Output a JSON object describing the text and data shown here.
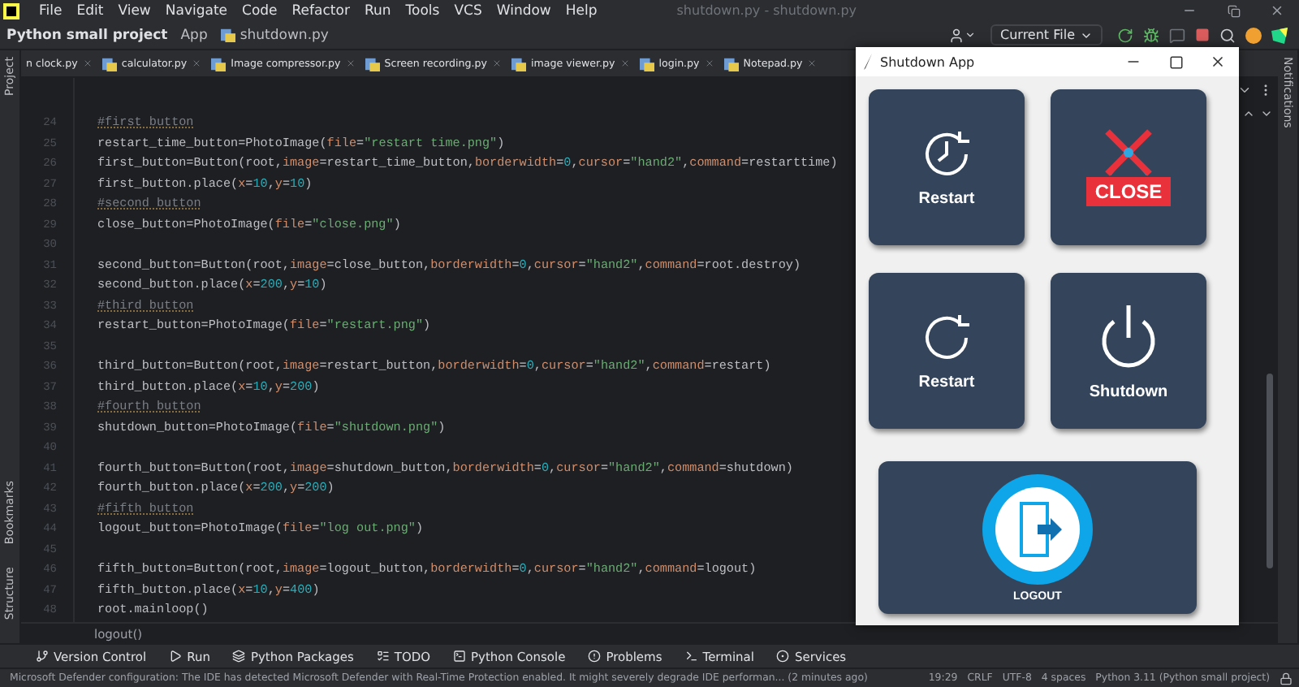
{
  "window": {
    "title": "shutdown.py - shutdown.py"
  },
  "menu": [
    "File",
    "Edit",
    "View",
    "Navigate",
    "Code",
    "Refactor",
    "Run",
    "Tools",
    "VCS",
    "Window",
    "Help"
  ],
  "breadcrumbs": [
    "Python small project",
    "App",
    "shutdown.py"
  ],
  "toolbar": {
    "run_configuration": "Current File"
  },
  "left_tools_top": [
    "Project"
  ],
  "left_tools_bottom": [
    "Bookmarks",
    "Structure"
  ],
  "right_tools": [
    "Notifications"
  ],
  "tabs": [
    "n clock.py",
    "calculator.py",
    "Image compressor.py",
    "Screen recording.py",
    "image viewer.py",
    "login.py",
    "Notepad.py"
  ],
  "editor": {
    "lines": [
      {
        "number": "24",
        "code": [
          {
            "kind": "comment",
            "text": "#first button"
          }
        ]
      },
      {
        "number": "25",
        "code": [
          {
            "kind": "plain",
            "text": "restart_time_button=PhotoImage("
          },
          {
            "kind": "param",
            "text": "file"
          },
          {
            "kind": "plain",
            "text": "="
          },
          {
            "kind": "string",
            "text": "\"restart time.png\""
          },
          {
            "kind": "plain",
            "text": ")"
          }
        ]
      },
      {
        "number": "26",
        "code": [
          {
            "kind": "plain",
            "text": "first_button=Button(root,"
          },
          {
            "kind": "param",
            "text": "image"
          },
          {
            "kind": "plain",
            "text": "=restart_time_button,"
          },
          {
            "kind": "param",
            "text": "borderwidth"
          },
          {
            "kind": "plain",
            "text": "="
          },
          {
            "kind": "number",
            "text": "0"
          },
          {
            "kind": "plain",
            "text": ","
          },
          {
            "kind": "param",
            "text": "cursor"
          },
          {
            "kind": "plain",
            "text": "="
          },
          {
            "kind": "string",
            "text": "\"hand2\""
          },
          {
            "kind": "plain",
            "text": ","
          },
          {
            "kind": "param",
            "text": "command"
          },
          {
            "kind": "plain",
            "text": "=restarttime)"
          }
        ]
      },
      {
        "number": "27",
        "code": [
          {
            "kind": "plain",
            "text": "first_button.place("
          },
          {
            "kind": "param",
            "text": "x"
          },
          {
            "kind": "plain",
            "text": "="
          },
          {
            "kind": "number",
            "text": "10"
          },
          {
            "kind": "plain",
            "text": ","
          },
          {
            "kind": "param",
            "text": "y"
          },
          {
            "kind": "plain",
            "text": "="
          },
          {
            "kind": "number",
            "text": "10"
          },
          {
            "kind": "plain",
            "text": ")"
          }
        ]
      },
      {
        "number": "28",
        "code": [
          {
            "kind": "comment",
            "text": "#second button"
          }
        ]
      },
      {
        "number": "29",
        "code": [
          {
            "kind": "plain",
            "text": "close_button=PhotoImage("
          },
          {
            "kind": "param",
            "text": "file"
          },
          {
            "kind": "plain",
            "text": "="
          },
          {
            "kind": "string",
            "text": "\"close.png\""
          },
          {
            "kind": "plain",
            "text": ")"
          }
        ]
      },
      {
        "number": "30"
      },
      {
        "number": "31",
        "code": [
          {
            "kind": "plain",
            "text": "second_button=Button(root,"
          },
          {
            "kind": "param",
            "text": "image"
          },
          {
            "kind": "plain",
            "text": "=close_button,"
          },
          {
            "kind": "param",
            "text": "borderwidth"
          },
          {
            "kind": "plain",
            "text": "="
          },
          {
            "kind": "number",
            "text": "0"
          },
          {
            "kind": "plain",
            "text": ","
          },
          {
            "kind": "param",
            "text": "cursor"
          },
          {
            "kind": "plain",
            "text": "="
          },
          {
            "kind": "string",
            "text": "\"hand2\""
          },
          {
            "kind": "plain",
            "text": ","
          },
          {
            "kind": "param",
            "text": "command"
          },
          {
            "kind": "plain",
            "text": "=root.destroy)"
          }
        ]
      },
      {
        "number": "32",
        "code": [
          {
            "kind": "plain",
            "text": "second_button.place("
          },
          {
            "kind": "param",
            "text": "x"
          },
          {
            "kind": "plain",
            "text": "="
          },
          {
            "kind": "number",
            "text": "200"
          },
          {
            "kind": "plain",
            "text": ","
          },
          {
            "kind": "param",
            "text": "y"
          },
          {
            "kind": "plain",
            "text": "="
          },
          {
            "kind": "number",
            "text": "10"
          },
          {
            "kind": "plain",
            "text": ")"
          }
        ]
      },
      {
        "number": "33",
        "code": [
          {
            "kind": "comment",
            "text": "#third button"
          }
        ]
      },
      {
        "number": "34",
        "code": [
          {
            "kind": "plain",
            "text": "restart_button=PhotoImage("
          },
          {
            "kind": "param",
            "text": "file"
          },
          {
            "kind": "plain",
            "text": "="
          },
          {
            "kind": "string",
            "text": "\"restart.png\""
          },
          {
            "kind": "plain",
            "text": ")"
          }
        ]
      },
      {
        "number": "35"
      },
      {
        "number": "36",
        "code": [
          {
            "kind": "plain",
            "text": "third_button=Button(root,"
          },
          {
            "kind": "param",
            "text": "image"
          },
          {
            "kind": "plain",
            "text": "=restart_button,"
          },
          {
            "kind": "param",
            "text": "borderwidth"
          },
          {
            "kind": "plain",
            "text": "="
          },
          {
            "kind": "number",
            "text": "0"
          },
          {
            "kind": "plain",
            "text": ","
          },
          {
            "kind": "param",
            "text": "cursor"
          },
          {
            "kind": "plain",
            "text": "="
          },
          {
            "kind": "string",
            "text": "\"hand2\""
          },
          {
            "kind": "plain",
            "text": ","
          },
          {
            "kind": "param",
            "text": "command"
          },
          {
            "kind": "plain",
            "text": "=restart)"
          }
        ]
      },
      {
        "number": "37",
        "code": [
          {
            "kind": "plain",
            "text": "third_button.place("
          },
          {
            "kind": "param",
            "text": "x"
          },
          {
            "kind": "plain",
            "text": "="
          },
          {
            "kind": "number",
            "text": "10"
          },
          {
            "kind": "plain",
            "text": ","
          },
          {
            "kind": "param",
            "text": "y"
          },
          {
            "kind": "plain",
            "text": "="
          },
          {
            "kind": "number",
            "text": "200"
          },
          {
            "kind": "plain",
            "text": ")"
          }
        ]
      },
      {
        "number": "38",
        "code": [
          {
            "kind": "comment",
            "text": "#fourth button"
          }
        ]
      },
      {
        "number": "39",
        "code": [
          {
            "kind": "plain",
            "text": "shutdown_button=PhotoImage("
          },
          {
            "kind": "param",
            "text": "file"
          },
          {
            "kind": "plain",
            "text": "="
          },
          {
            "kind": "string",
            "text": "\"shutdown.png\""
          },
          {
            "kind": "plain",
            "text": ")"
          }
        ]
      },
      {
        "number": "40"
      },
      {
        "number": "41",
        "code": [
          {
            "kind": "plain",
            "text": "fourth_button=Button(root,"
          },
          {
            "kind": "param",
            "text": "image"
          },
          {
            "kind": "plain",
            "text": "=shutdown_button,"
          },
          {
            "kind": "param",
            "text": "borderwidth"
          },
          {
            "kind": "plain",
            "text": "="
          },
          {
            "kind": "number",
            "text": "0"
          },
          {
            "kind": "plain",
            "text": ","
          },
          {
            "kind": "param",
            "text": "cursor"
          },
          {
            "kind": "plain",
            "text": "="
          },
          {
            "kind": "string",
            "text": "\"hand2\""
          },
          {
            "kind": "plain",
            "text": ","
          },
          {
            "kind": "param",
            "text": "command"
          },
          {
            "kind": "plain",
            "text": "=shutdown)"
          }
        ]
      },
      {
        "number": "42",
        "code": [
          {
            "kind": "plain",
            "text": "fourth_button.place("
          },
          {
            "kind": "param",
            "text": "x"
          },
          {
            "kind": "plain",
            "text": "="
          },
          {
            "kind": "number",
            "text": "200"
          },
          {
            "kind": "plain",
            "text": ","
          },
          {
            "kind": "param",
            "text": "y"
          },
          {
            "kind": "plain",
            "text": "="
          },
          {
            "kind": "number",
            "text": "200"
          },
          {
            "kind": "plain",
            "text": ")"
          }
        ]
      },
      {
        "number": "43",
        "code": [
          {
            "kind": "comment",
            "text": "#fifth button"
          }
        ]
      },
      {
        "number": "44",
        "code": [
          {
            "kind": "plain",
            "text": "logout_button=PhotoImage("
          },
          {
            "kind": "param",
            "text": "file"
          },
          {
            "kind": "plain",
            "text": "="
          },
          {
            "kind": "string",
            "text": "\"log out.png\""
          },
          {
            "kind": "plain",
            "text": ")"
          }
        ]
      },
      {
        "number": "45"
      },
      {
        "number": "46",
        "code": [
          {
            "kind": "plain",
            "text": "fifth_button=Button(root,"
          },
          {
            "kind": "param",
            "text": "image"
          },
          {
            "kind": "plain",
            "text": "=logout_button,"
          },
          {
            "kind": "param",
            "text": "borderwidth"
          },
          {
            "kind": "plain",
            "text": "="
          },
          {
            "kind": "number",
            "text": "0"
          },
          {
            "kind": "plain",
            "text": ","
          },
          {
            "kind": "param",
            "text": "cursor"
          },
          {
            "kind": "plain",
            "text": "="
          },
          {
            "kind": "string",
            "text": "\"hand2\""
          },
          {
            "kind": "plain",
            "text": ","
          },
          {
            "kind": "param",
            "text": "command"
          },
          {
            "kind": "plain",
            "text": "=logout)"
          }
        ]
      },
      {
        "number": "47",
        "code": [
          {
            "kind": "plain",
            "text": "fifth_button.place("
          },
          {
            "kind": "param",
            "text": "x"
          },
          {
            "kind": "plain",
            "text": "="
          },
          {
            "kind": "number",
            "text": "10"
          },
          {
            "kind": "plain",
            "text": ","
          },
          {
            "kind": "param",
            "text": "y"
          },
          {
            "kind": "plain",
            "text": "="
          },
          {
            "kind": "number",
            "text": "400"
          },
          {
            "kind": "plain",
            "text": ")"
          }
        ]
      },
      {
        "number": "48",
        "code": [
          {
            "kind": "plain",
            "text": "root.mainloop()"
          }
        ]
      }
    ]
  },
  "code_breadcrumb": "logout()",
  "tool_windows": [
    {
      "kind": "vcs",
      "label": "Version Control"
    },
    {
      "kind": "run",
      "label": "Run"
    },
    {
      "kind": "packages",
      "label": "Python Packages"
    },
    {
      "kind": "todo",
      "label": "TODO"
    },
    {
      "kind": "console",
      "label": "Python Console"
    },
    {
      "kind": "problems",
      "label": "Problems"
    },
    {
      "kind": "terminal",
      "label": "Terminal"
    },
    {
      "kind": "services",
      "label": "Services"
    }
  ],
  "status_bar": {
    "message": "Microsoft Defender configuration: The IDE has detected Microsoft Defender with Real-Time Protection enabled. It might severely degrade IDE performan... (2 minutes ago)",
    "items": [
      "19:29",
      "CRLF",
      "UTF-8",
      "4 spaces",
      "Python 3.11 (Python small project)"
    ]
  },
  "app_window": {
    "title": "Shutdown App",
    "buttons": [
      {
        "kind": "restart-time",
        "label": "Restart"
      },
      {
        "kind": "close",
        "label": "CLOSE"
      },
      {
        "kind": "restart",
        "label": "Restart"
      },
      {
        "kind": "shutdown",
        "label": "Shutdown"
      },
      {
        "kind": "logout",
        "label": "LOGOUT"
      }
    ]
  }
}
